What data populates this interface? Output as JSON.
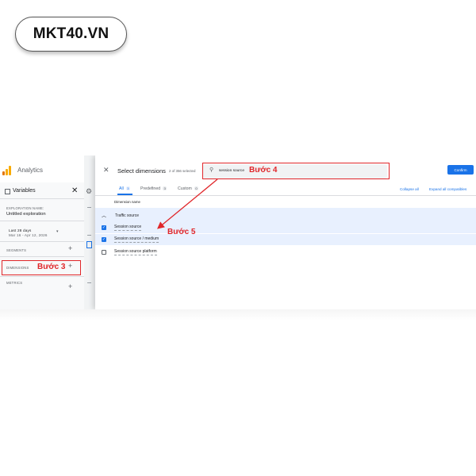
{
  "brand": {
    "logo_text": "MKT40.VN"
  },
  "left_panel": {
    "app_name": "Analytics",
    "variables_label": "Variables",
    "exploration_name_label": "EXPLORATION NAME:",
    "exploration_name": "Untitled exploration",
    "date_range_label": "Last 28 days",
    "date_range": "Mar 16 - Apr 12, 2026",
    "segments_label": "SEGMENTS",
    "dimensions_label": "DIMENSIONS",
    "metrics_label": "METRICS"
  },
  "dialog": {
    "title": "Select dimensions",
    "subtitle": "2 of 356 selected",
    "search_value": "session source",
    "confirm_label": "Confirm",
    "tabs": [
      {
        "label": "All",
        "count": "3"
      },
      {
        "label": "Predefined",
        "count": "3"
      },
      {
        "label": "Custom",
        "count": "0"
      }
    ],
    "collapse_all": "Collapse all",
    "expand_all": "Expand all compatibles",
    "column_header": "Dimension name",
    "group_label": "Traffic source",
    "items": [
      {
        "label": "Session source",
        "checked": true
      },
      {
        "label": "Session source / medium",
        "checked": true
      },
      {
        "label": "Session source platform",
        "checked": false
      }
    ]
  },
  "annotations": {
    "step3": "Bước 3",
    "step4": "Bước 4",
    "step5": "Bước 5",
    "color": "#e0262a"
  },
  "colors": {
    "accent": "#1a73e8",
    "selected_row": "#e8f0fe",
    "annotation_red": "#e0262a"
  }
}
